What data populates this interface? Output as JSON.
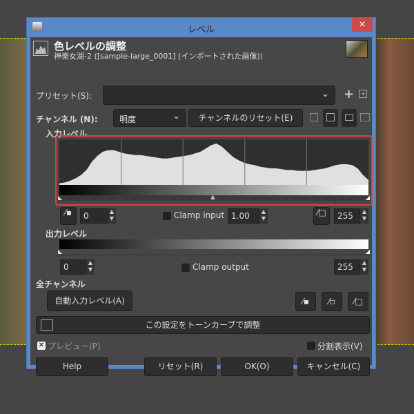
{
  "window": {
    "title": "レベル",
    "close": "×"
  },
  "header": {
    "title": "色レベルの調整",
    "subtitle": "神楽女湖-2 ([sample-large_0001] (インポートされた画像))"
  },
  "preset": {
    "label": "プリセット(S):",
    "value": "",
    "add": "+",
    "menu": "◂"
  },
  "channel": {
    "label": "チャンネル (N):",
    "value": "明度",
    "reset": "チャンネルのリセット(E)"
  },
  "input_levels": {
    "label": "入力レベル",
    "low": "0",
    "gamma": "1.00",
    "high": "255",
    "clamp": "Clamp input",
    "clamp_checked": false,
    "histogram": [
      2,
      3,
      5,
      8,
      12,
      18,
      28,
      35,
      40,
      42,
      42,
      40,
      38,
      37,
      36,
      36,
      35,
      34,
      33,
      32,
      32,
      33,
      34,
      35,
      36,
      38,
      40,
      44,
      48,
      50,
      46,
      40,
      34,
      30,
      27,
      25,
      24,
      22,
      21,
      20,
      20,
      19,
      18,
      18,
      17,
      17,
      17,
      18,
      19,
      20,
      22,
      24,
      25,
      25,
      24,
      20,
      12,
      6
    ]
  },
  "output_levels": {
    "label": "出力レベル",
    "low": "0",
    "high": "255",
    "clamp": "Clamp output",
    "clamp_checked": false
  },
  "all_channels": {
    "label": "全チャンネル",
    "auto": "自動入力レベル(A)"
  },
  "curves_button": "この設定をトーンカーブで調整",
  "preview": {
    "label": "プレビュー(P)",
    "checked": true
  },
  "split": {
    "label": "分割表示(V)",
    "checked": false
  },
  "buttons": {
    "help": "Help",
    "reset": "リセット(R)",
    "ok": "OK(O)",
    "cancel": "キャンセル(C)"
  },
  "colors": {
    "titlebar": "#5a8ac6",
    "close": "#c94a4a",
    "highlight": "#e04040"
  }
}
